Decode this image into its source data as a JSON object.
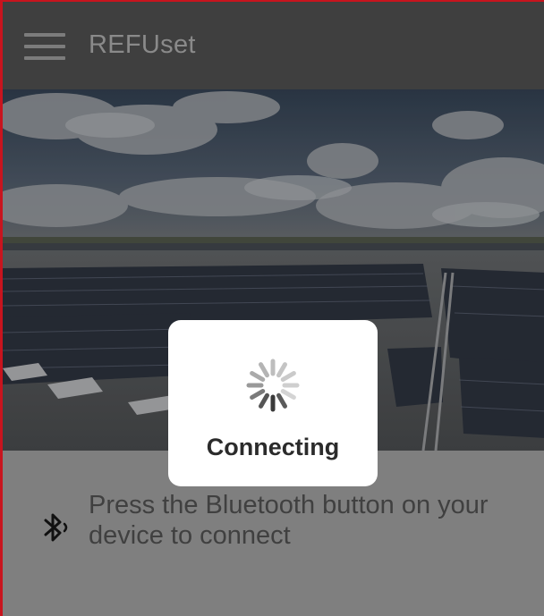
{
  "header": {
    "title": "REFUset",
    "menu_icon": "hamburger-menu-icon"
  },
  "hero": {
    "image": "solar-panel-rooftop-photo"
  },
  "connect": {
    "icon": "bluetooth-icon",
    "instruction": "Press the Bluetooth button on your device to connect"
  },
  "dialog": {
    "icon": "loading-spinner-icon",
    "label": "Connecting"
  },
  "colors": {
    "header_bg": "#3f3f3f",
    "accent_border": "#c8141e",
    "dialog_bg": "#ffffff"
  }
}
